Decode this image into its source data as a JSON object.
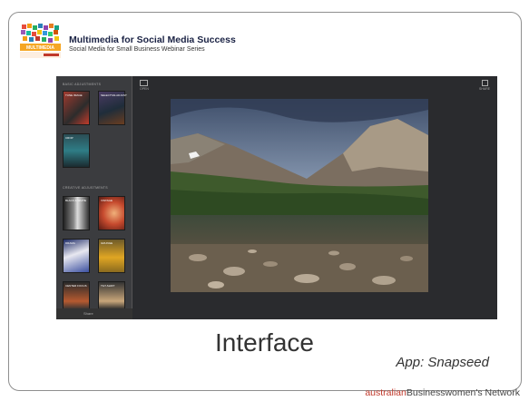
{
  "header": {
    "title": "Multimedia for Social Media Success",
    "subtitle": "Social Media for Small Business Webinar Series",
    "logo_text": "MULTIMEDIA"
  },
  "app_ui": {
    "basic_section_label": "BASIC ADJUSTMENTS",
    "creative_section_label": "CREATIVE ADJUSTMENTS",
    "basic_tiles": [
      "TUNE IMAGE",
      "SELECTIVE ADJUST",
      "CROP"
    ],
    "creative_tiles": [
      "BLACK & WHITE",
      "VINTAGE",
      "DRAMA",
      "GRUNGE",
      "CENTER FOCUS",
      "TILT-SHIFT"
    ],
    "top_left_button": "OPEN",
    "top_right_button": "SHARE",
    "sidebar_footer": "Share"
  },
  "slide": {
    "heading": "Interface",
    "app_caption": "App: Snapseed"
  },
  "footer": {
    "brand_first": "australian",
    "brand_rest": "Businesswomen's Network"
  },
  "colors": {
    "app_background": "#2a2b2e",
    "sidebar": "#3b3c3f",
    "brand_red": "#c0392b",
    "title_navy": "#1a2244"
  }
}
